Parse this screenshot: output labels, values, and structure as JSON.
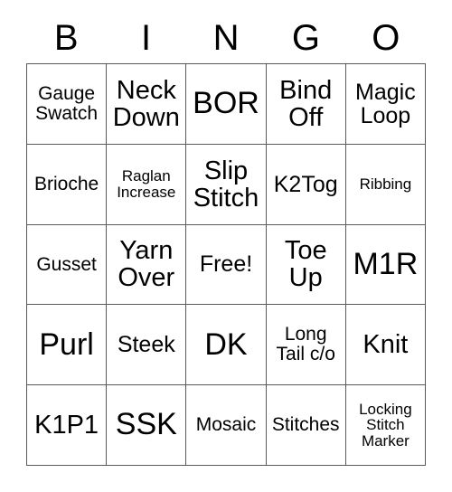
{
  "card": {
    "header": [
      "B",
      "I",
      "N",
      "G",
      "O"
    ],
    "rows": [
      [
        {
          "text": "Gauge Swatch",
          "size": "sm"
        },
        {
          "text": "Neck Down",
          "size": "lg"
        },
        {
          "text": "BOR",
          "size": "xl"
        },
        {
          "text": "Bind Off",
          "size": "lg"
        },
        {
          "text": "Magic Loop",
          "size": "md"
        }
      ],
      [
        {
          "text": "Brioche",
          "size": "sm"
        },
        {
          "text": "Raglan Increase",
          "size": "xs"
        },
        {
          "text": "Slip Stitch",
          "size": "lg"
        },
        {
          "text": "K2Tog",
          "size": "md"
        },
        {
          "text": "Ribbing",
          "size": "xs"
        }
      ],
      [
        {
          "text": "Gusset",
          "size": "sm"
        },
        {
          "text": "Yarn Over",
          "size": "lg"
        },
        {
          "text": "Free!",
          "size": "md"
        },
        {
          "text": "Toe Up",
          "size": "lg"
        },
        {
          "text": "M1R",
          "size": "xl"
        }
      ],
      [
        {
          "text": "Purl",
          "size": "xl"
        },
        {
          "text": "Steek",
          "size": "md"
        },
        {
          "text": "DK",
          "size": "xl"
        },
        {
          "text": "Long Tail c/o",
          "size": "sm"
        },
        {
          "text": "Knit",
          "size": "lg"
        }
      ],
      [
        {
          "text": "K1P1",
          "size": "lg"
        },
        {
          "text": "SSK",
          "size": "xl"
        },
        {
          "text": "Mosaic",
          "size": "sm"
        },
        {
          "text": "Stitches",
          "size": "sm"
        },
        {
          "text": "Locking Stitch Marker",
          "size": "xs"
        }
      ]
    ],
    "free_space_label": "Free!",
    "colors": {
      "background": "#ffffff",
      "text": "#000000",
      "grid_line": "#5a5a5a"
    }
  }
}
